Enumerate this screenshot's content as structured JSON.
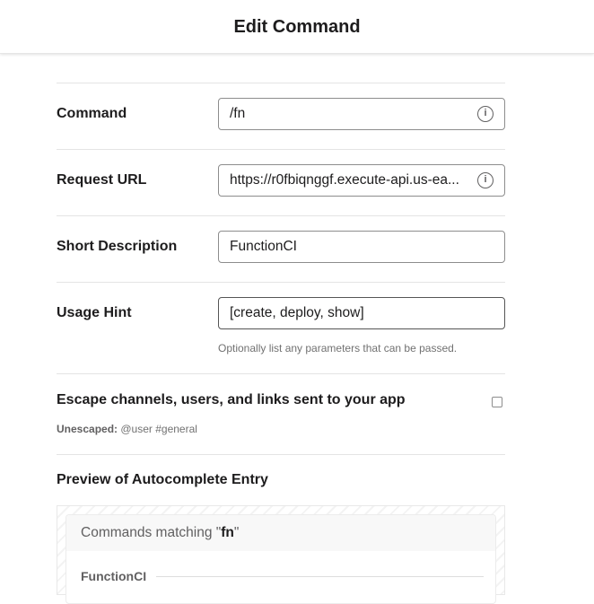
{
  "header": {
    "title": "Edit Command"
  },
  "form": {
    "command": {
      "label": "Command",
      "value": "/fn"
    },
    "request_url": {
      "label": "Request URL",
      "value": "https://r0fbiqnggf.execute-api.us-ea..."
    },
    "short_description": {
      "label": "Short Description",
      "value": "FunctionCI"
    },
    "usage_hint": {
      "label": "Usage Hint",
      "value": "[create, deploy, show]",
      "help": "Optionally list any parameters that can be passed."
    },
    "escape": {
      "label": "Escape channels, users, and links sent to your app",
      "checked": false,
      "note_label": "Unescaped:",
      "note_value": "@user #general"
    }
  },
  "preview": {
    "title": "Preview of Autocomplete Entry",
    "header_prefix": "Commands matching \"",
    "header_term": "fn",
    "header_suffix": "\"",
    "entry": "FunctionCI"
  },
  "icons": {
    "info": "info-circle-icon"
  }
}
